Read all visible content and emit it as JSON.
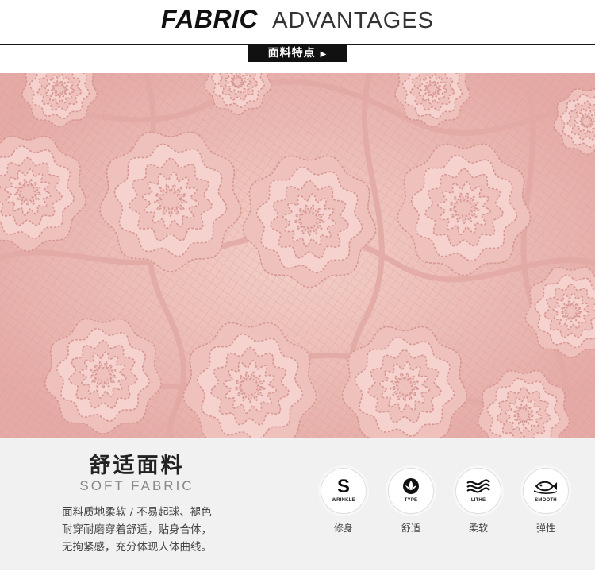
{
  "header": {
    "title_bold": "FABRIC",
    "title_light": "ADVANTAGES",
    "sub_label": "面料特点",
    "sub_arrow": "▶"
  },
  "info": {
    "cn_title": "舒适面料",
    "en_title": "SOFT FABRIC",
    "description_lines": [
      "面料质地柔软 / 不易起球、褪色",
      "耐穿耐磨穿着舒适，贴身合体，",
      "无拘紧感，充分体现人体曲线。"
    ]
  },
  "features": [
    {
      "icon": "wrinkle-s-icon",
      "tag": "WRINKLE",
      "label": "修身"
    },
    {
      "icon": "flower-type-icon",
      "tag": "TYPE",
      "label": "舒适"
    },
    {
      "icon": "waves-lithe-icon",
      "tag": "LITHE",
      "label": "柔软"
    },
    {
      "icon": "fish-smooth-icon",
      "tag": "SMOOTH",
      "label": "弹性"
    }
  ],
  "colors": {
    "lace": "#e9b4b1",
    "lace_flower": "#eec1bd",
    "lace_dark": "#d79792",
    "panel": "#f1f1f1",
    "text_dark": "#222222"
  }
}
